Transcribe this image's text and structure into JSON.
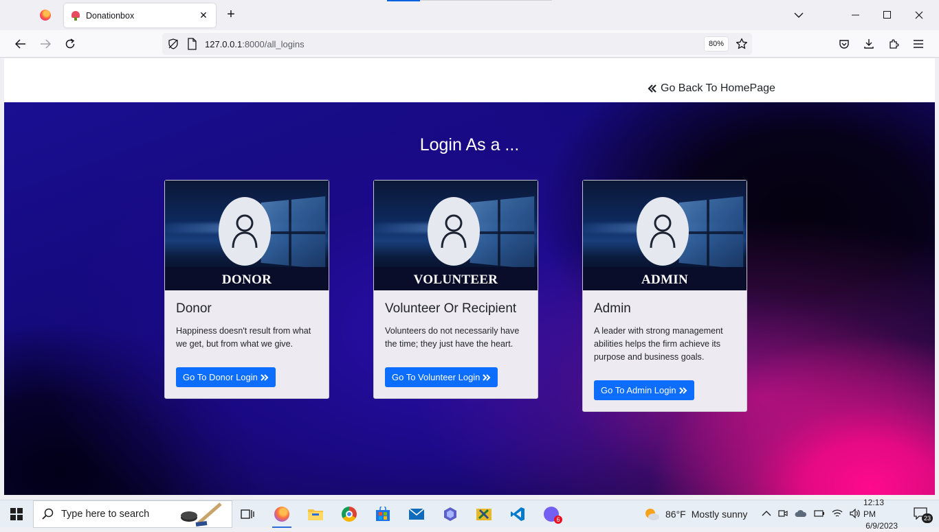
{
  "browser": {
    "tab_title": "Donationbox",
    "url_host": "127.0.0.1",
    "url_path": ":8000/all_logins",
    "zoom": "80%"
  },
  "page": {
    "back_link": "Go Back To HomePage",
    "heading": "Login As a ...",
    "cards": [
      {
        "image_label": "DONOR",
        "title": "Donor",
        "text": "Happiness doesn't result from what we get, but from what we give.",
        "button": "Go To Donor Login"
      },
      {
        "image_label": "VOLUNTEER",
        "title": "Volunteer Or Recipient",
        "text": "Volunteers do not necessarily have the time; they just have the heart.",
        "button": "Go To Volunteer Login"
      },
      {
        "image_label": "ADMIN",
        "title": "Admin",
        "text": "A leader with strong management abilities helps the firm achieve its purpose and business goals.",
        "button": "Go To Admin Login"
      }
    ]
  },
  "taskbar": {
    "search_placeholder": "Type here to search",
    "weather_temp": "86°F",
    "weather_desc": "Mostly sunny",
    "time": "12:13 PM",
    "date": "6/9/2023",
    "notification_count": "23",
    "teams_badge": "6"
  },
  "colors": {
    "button_blue": "#0d6efd",
    "accent_blue": "#0061e0"
  }
}
